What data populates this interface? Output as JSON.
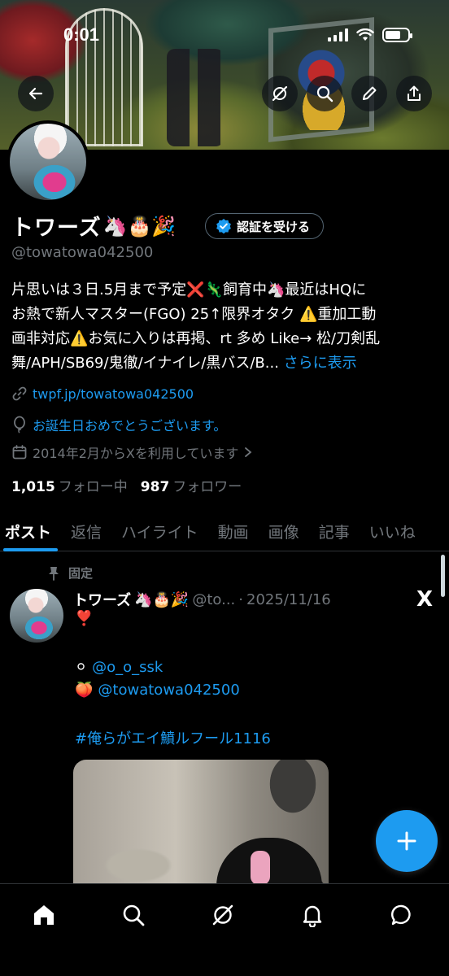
{
  "status_bar": {
    "time": "0:01"
  },
  "profile": {
    "display_name": "トワーズ",
    "name_emojis": "🦄🎂🎉",
    "handle": "@towatowa042500",
    "verify_button_label": "認証を受ける",
    "bio_lines": [
      "片思いは３日.5月まで予定❌🦎飼育中🦄最近はHQに",
      "お熱で新人マスター(FGO) 25↑限界オタク ⚠️重加工動",
      "画非対応⚠️お気に入りは再掲、rt 多め Like→ 松/刀剣乱",
      "舞/APH/SB69/鬼徹/イナイレ/黒バス/B..."
    ],
    "bio_more": "さらに表示",
    "link": "twpf.jp/towatowa042500",
    "birthday_message": "お誕生日おめでとうございます。",
    "joined": "2014年2月からXを利用しています",
    "following_count": "1,015",
    "following_label": "フォロー中",
    "followers_count": "987",
    "followers_label": "フォロワー"
  },
  "tabs": [
    {
      "label": "ポスト",
      "active": true
    },
    {
      "label": "返信"
    },
    {
      "label": "ハイライト"
    },
    {
      "label": "動画"
    },
    {
      "label": "画像"
    },
    {
      "label": "記事"
    },
    {
      "label": "いいね"
    }
  ],
  "pinned_post": {
    "pinned_label": "固定",
    "author_name": "トワーズ",
    "author_emojis": "🦄🎂🎉",
    "author_handle": "@to...",
    "separator": "·",
    "date": "2025/11/16",
    "x_mark": "X",
    "line1": "❣️",
    "mention1_emoji": "⚪",
    "mention1": "@o_o_ssk",
    "mention2_emoji": "🍑",
    "mention2": "@towatowa042500",
    "hashtag": "#俺らがエイ鱝ルフール1116"
  },
  "colors": {
    "accent": "#1d9bf0",
    "secondary_text": "#71767b",
    "background": "#000000",
    "divider": "#2f3336"
  },
  "icons": {
    "back": "arrow-left-icon",
    "grok": "grok-icon",
    "search": "search-icon",
    "edit": "pencil-icon",
    "share": "share-icon",
    "verified": "verified-badge-icon",
    "link": "link-icon",
    "birthday": "balloon-icon",
    "calendar": "calendar-icon",
    "pin": "pin-icon",
    "compose": "plus-icon",
    "nav": [
      "home-icon",
      "search-icon",
      "grok-icon",
      "bell-icon",
      "chat-icon"
    ]
  }
}
